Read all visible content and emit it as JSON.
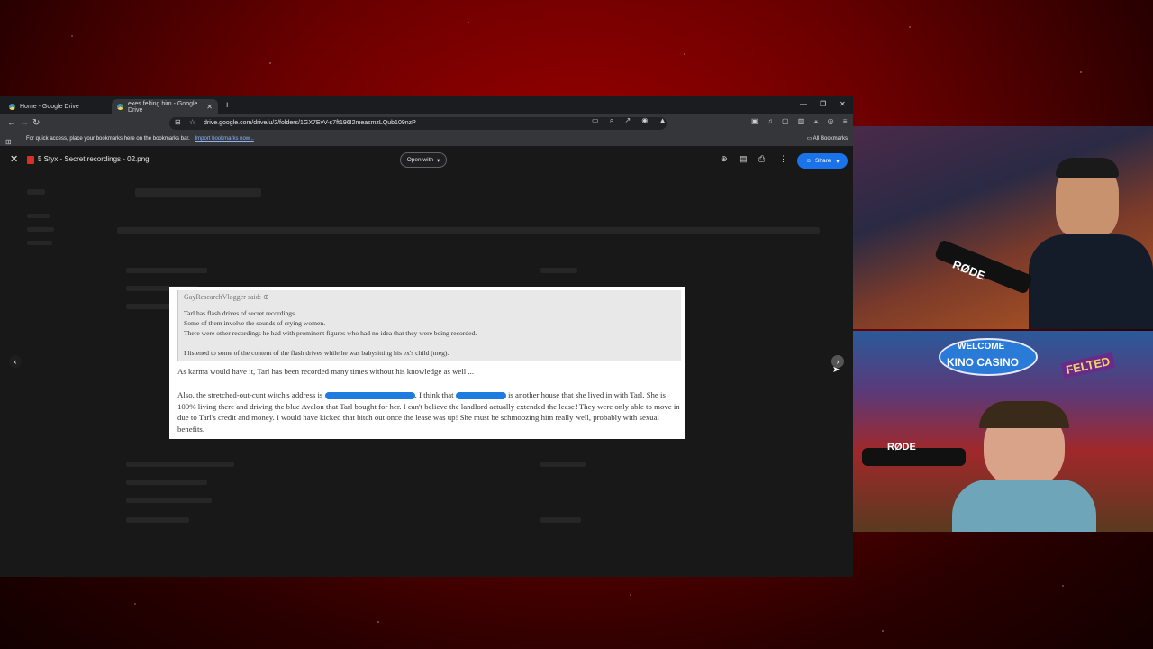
{
  "browser": {
    "tabs": [
      {
        "label": "Home - Google Drive",
        "active": false
      },
      {
        "label": "exes felting him - Google Drive",
        "active": true
      }
    ],
    "url": "drive.google.com/drive/u/2/folders/1GX7EvV-s7ft196I2measmzLQub109nzP",
    "bookmarks_bar": {
      "prompt": "For quick access, place your bookmarks here on the bookmarks bar.",
      "import_link": "Import bookmarks now...",
      "all_bookmarks": "All Bookmarks"
    }
  },
  "viewer": {
    "filename": "5 Styx - Secret recordings - 02.png",
    "open_with_label": "Open with",
    "share_label": "Share"
  },
  "document": {
    "quote_author": "GayResearchVlogger said:",
    "quote_lines": [
      "Tarl has flash drives of secret recordings.",
      "Some of them involve the sounds of crying women.",
      "There were other recordings he had with prominent figures who had no idea that they were being recorded.",
      "I listened to some of the content of the flash drives while he was babysitting his ex's child (meg)."
    ],
    "para1": "As karma would have it, Tarl has been recorded many times without his knowledge as well ...",
    "para2_a": "Also, the stretched-out-cunt witch's address is",
    "para2_b": ". I think that",
    "para2_c": "is another house that she lived in with Tarl. She is 100% living there and driving the blue Avalon that Tarl bought for her. I can't believe the landlord actually extended the lease! They were only able to move in due to Tarl's credit and money. I would have kicked that bitch out once the lease was up! She must be schmoozing him really well, probably with sexual benefits."
  },
  "overlay": {
    "cam1_caption": "RØDE",
    "cam2_caption": "RØDE",
    "sign_welcome": "WELCOME",
    "sign_casino": "KINO CASINO",
    "sign_felted": "FELTED"
  },
  "colors": {
    "accent_blue": "#1a73e8",
    "redaction": "#1e7be0",
    "background_red": "#a00000"
  }
}
